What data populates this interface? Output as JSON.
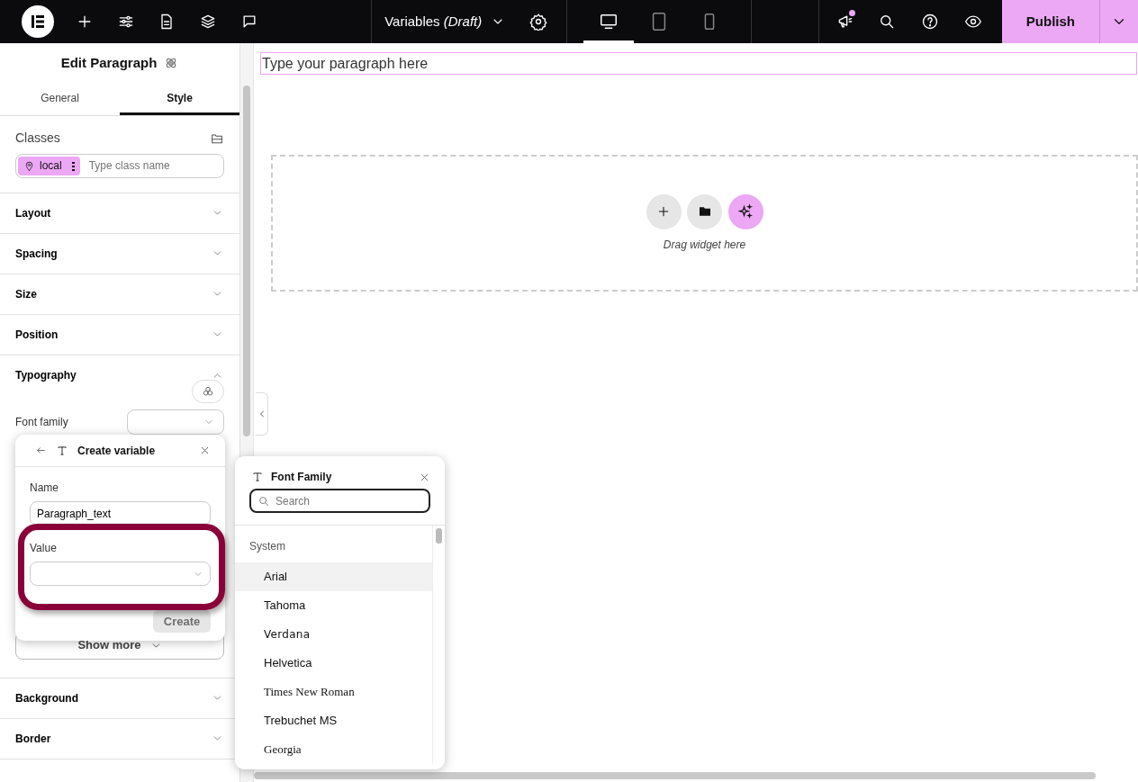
{
  "topbar": {
    "page_title": "Variables *(Draft)*",
    "devices": [
      {
        "kind": "desktop",
        "selected": true
      },
      {
        "kind": "tablet",
        "selected": false
      },
      {
        "kind": "mobile",
        "selected": false
      }
    ],
    "notification": true,
    "publish": "Publish"
  },
  "panel": {
    "title": "Edit Paragraph",
    "tabs": [
      {
        "label": "General",
        "selected": false
      },
      {
        "label": "Style",
        "selected": true
      }
    ],
    "classes": {
      "label": "Classes",
      "chip": "local",
      "placeholder": "Type class name"
    },
    "sections": [
      {
        "label": "Layout",
        "expanded": false
      },
      {
        "label": "Spacing",
        "expanded": false
      },
      {
        "label": "Size",
        "expanded": false
      },
      {
        "label": "Position",
        "expanded": false
      },
      {
        "label": "Typography",
        "expanded": true
      },
      {
        "label": "Background",
        "expanded": false
      },
      {
        "label": "Border",
        "expanded": false
      }
    ],
    "typography": {
      "field_label": "Font family",
      "show_more": "Show more"
    }
  },
  "canvas": {
    "paragraph": "Type your paragraph here",
    "drop_hint": "Drag widget here"
  },
  "create_variable": {
    "title": "Create variable",
    "name_label": "Name",
    "name_value": "Paragraph_text",
    "value_label": "Value",
    "button": "Create",
    "button_disabled": true
  },
  "font_family": {
    "title": "Font Family",
    "search_placeholder": "Search",
    "group": "System",
    "fonts": [
      {
        "label": "Arial",
        "kind": "sans",
        "selected": true
      },
      {
        "label": "Tahoma",
        "kind": "sans",
        "selected": false
      },
      {
        "label": "Verdana",
        "kind": "wide",
        "selected": false
      },
      {
        "label": "Helvetica",
        "kind": "sans",
        "selected": false
      },
      {
        "label": "Times New Roman",
        "kind": "serif",
        "selected": false
      },
      {
        "label": "Trebuchet MS",
        "kind": "sans",
        "selected": false
      },
      {
        "label": "Georgia",
        "kind": "serif",
        "selected": false
      }
    ]
  }
}
